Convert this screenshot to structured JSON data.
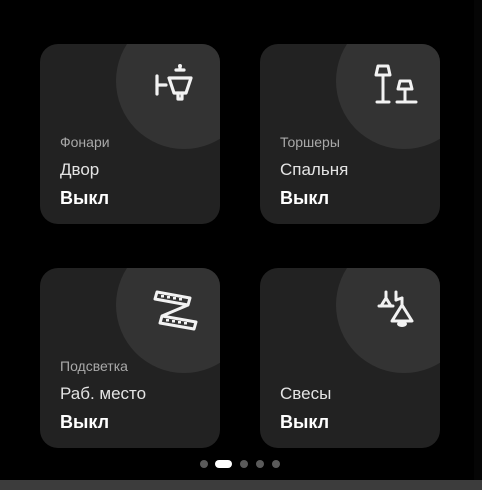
{
  "tiles": [
    {
      "category": "Фонари",
      "room": "Двор",
      "state": "Выкл",
      "icon": "street-lantern-icon"
    },
    {
      "category": "Торшеры",
      "room": "Спальня",
      "state": "Выкл",
      "icon": "floor-lamps-icon"
    },
    {
      "category": "Подсветка",
      "room": "Раб. место",
      "state": "Выкл",
      "icon": "led-strip-icon"
    },
    {
      "category": "",
      "room": "Свесы",
      "state": "Выкл",
      "icon": "pendant-lamp-icon"
    }
  ],
  "pager": {
    "count": 5,
    "active_index": 1
  },
  "colors": {
    "background": "#000000",
    "tile": "#222222",
    "icon_circle": "#333333",
    "icon": "#f2f2f2",
    "category_text": "#a9a9a9",
    "active_dot": "#ffffff",
    "inactive_dot": "#5a5a5a"
  }
}
